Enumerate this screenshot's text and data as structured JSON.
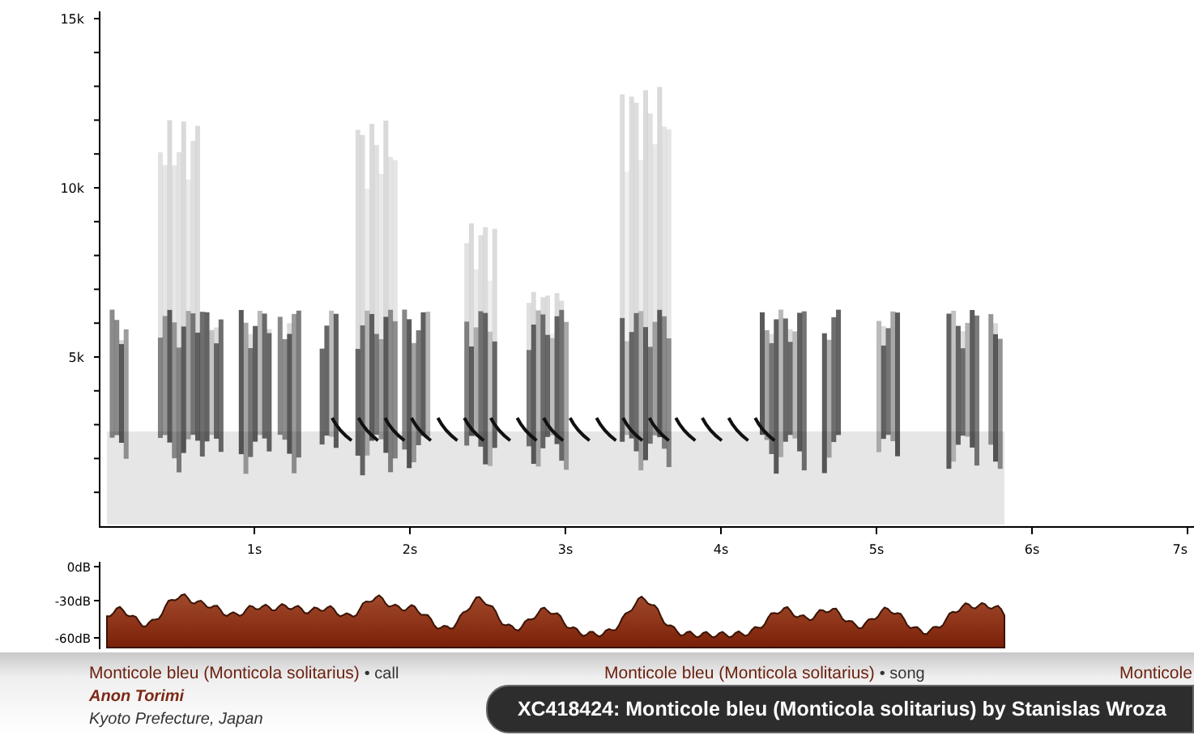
{
  "spectrogram": {
    "y_ticks": [
      "15k",
      "10k",
      "5k"
    ],
    "x_ticks": [
      "1s",
      "2s",
      "3s",
      "4s",
      "5s",
      "6s",
      "7s"
    ]
  },
  "amplitude": {
    "y_ticks": [
      "0dB",
      "-30dB",
      "-60dB"
    ]
  },
  "recordings": [
    {
      "title": "Monticole bleu (Monticola solitarius)",
      "sound_type": "• call",
      "recordist": "Anon Torimi",
      "location": "Kyoto Prefecture, Japan"
    },
    {
      "title": "Monticole bleu (Monticola solitarius)",
      "sound_type": "• song"
    },
    {
      "title": "Monticole"
    }
  ],
  "caption": "XC418424: Monticole bleu (Monticola solitarius) by Stanislas Wroza"
}
